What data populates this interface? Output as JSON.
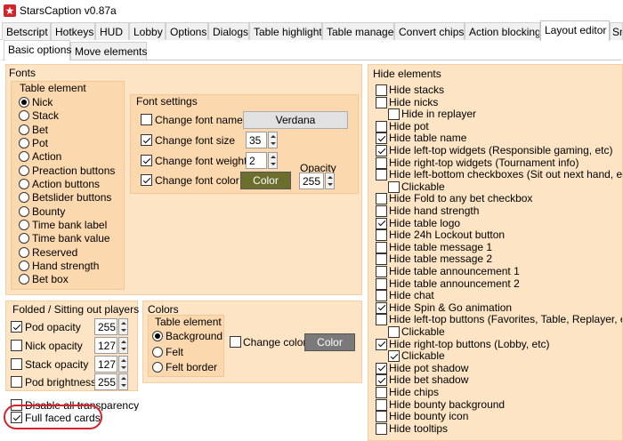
{
  "window": {
    "title": "StarsCaption v0.87a"
  },
  "main_tabs": [
    "Betscript",
    "Hotkeys",
    "HUD",
    "Lobby",
    "Options",
    "Dialogs",
    "Table highlight",
    "Table manager",
    "Convert chips",
    "Action blocking",
    "Layout editor",
    "Sn"
  ],
  "main_tabs_active": "Layout editor",
  "sub_tabs": [
    "Basic options",
    "Move elements"
  ],
  "fonts": {
    "title": "Fonts",
    "table_element_title": "Table element",
    "elements": [
      "Nick",
      "Stack",
      "Bet",
      "Pot",
      "Action",
      "Preaction buttons",
      "Action buttons",
      "Betslider buttons",
      "Bounty",
      "Time bank label",
      "Time bank value",
      "Reserved",
      "Hand strength",
      "Bet box"
    ],
    "selected": "Nick",
    "settings_title": "Font settings",
    "change_font_name": "Change font name",
    "font_name_value": "Verdana",
    "change_font_size": "Change font size",
    "font_size_value": "35",
    "change_font_weight": "Change font weight",
    "font_weight_value": "2",
    "change_font_color": "Change font color",
    "color_button": "Color",
    "opacity_label": "Opacity",
    "opacity_value": "255",
    "color_swatch": "#6b6e2c"
  },
  "folded": {
    "title": "Folded / Sitting out players",
    "pod_opacity": "Pod opacity",
    "pod_opacity_value": "255",
    "nick_opacity": "Nick opacity",
    "nick_opacity_value": "127",
    "stack_opacity": "Stack opacity",
    "stack_opacity_value": "127",
    "pod_brightness": "Pod brightness",
    "pod_brightness_value": "255"
  },
  "colors": {
    "title": "Colors",
    "table_element_title": "Table element",
    "options": [
      "Background",
      "Felt",
      "Felt border"
    ],
    "selected": "Background",
    "change_color": "Change color",
    "color_button": "Color",
    "color_swatch": "#7a7a7a"
  },
  "bottom": {
    "disable_transparency": "Disable all transparency",
    "full_faced_cards": "Full faced cards"
  },
  "hide": {
    "title": "Hide elements",
    "items": [
      {
        "label": "Hide stacks",
        "checked": false,
        "indent": false
      },
      {
        "label": "Hide nicks",
        "checked": false,
        "indent": false
      },
      {
        "label": "Hide in replayer",
        "checked": false,
        "indent": true
      },
      {
        "label": "Hide pot",
        "checked": false,
        "indent": false
      },
      {
        "label": "Hide table name",
        "checked": true,
        "indent": false
      },
      {
        "label": "Hide left-top widgets (Responsible gaming, etc)",
        "checked": true,
        "indent": false
      },
      {
        "label": "Hide right-top widgets (Tournament info)",
        "checked": false,
        "indent": false
      },
      {
        "label": "Hide left-bottom checkboxes (Sit out next hand, etc",
        "checked": false,
        "indent": false
      },
      {
        "label": "Clickable",
        "checked": false,
        "indent": true
      },
      {
        "label": "Hide Fold to any bet checkbox",
        "checked": false,
        "indent": false
      },
      {
        "label": "Hide hand strength",
        "checked": false,
        "indent": false
      },
      {
        "label": "Hide table logo",
        "checked": true,
        "indent": false
      },
      {
        "label": "Hide 24h Lockout button",
        "checked": false,
        "indent": false
      },
      {
        "label": "Hide table message 1",
        "checked": false,
        "indent": false
      },
      {
        "label": "Hide table message 2",
        "checked": false,
        "indent": false
      },
      {
        "label": "Hide table announcement 1",
        "checked": false,
        "indent": false
      },
      {
        "label": "Hide table announcement 2",
        "checked": false,
        "indent": false
      },
      {
        "label": "Hide chat",
        "checked": false,
        "indent": false
      },
      {
        "label": "Hide Spin & Go animation",
        "checked": true,
        "indent": false
      },
      {
        "label": "Hide left-top buttons (Favorites, Table, Replayer, etc",
        "checked": false,
        "indent": false
      },
      {
        "label": "Clickable",
        "checked": false,
        "indent": true
      },
      {
        "label": "Hide right-top buttons (Lobby, etc)",
        "checked": true,
        "indent": false
      },
      {
        "label": "Clickable",
        "checked": true,
        "indent": true
      },
      {
        "label": "Hide pot shadow",
        "checked": true,
        "indent": false
      },
      {
        "label": "Hide bet shadow",
        "checked": true,
        "indent": false
      },
      {
        "label": "Hide chips",
        "checked": false,
        "indent": false
      },
      {
        "label": "Hide bounty background",
        "checked": false,
        "indent": false
      },
      {
        "label": "Hide bounty icon",
        "checked": false,
        "indent": false
      },
      {
        "label": "Hide tooltips",
        "checked": false,
        "indent": false
      }
    ]
  }
}
